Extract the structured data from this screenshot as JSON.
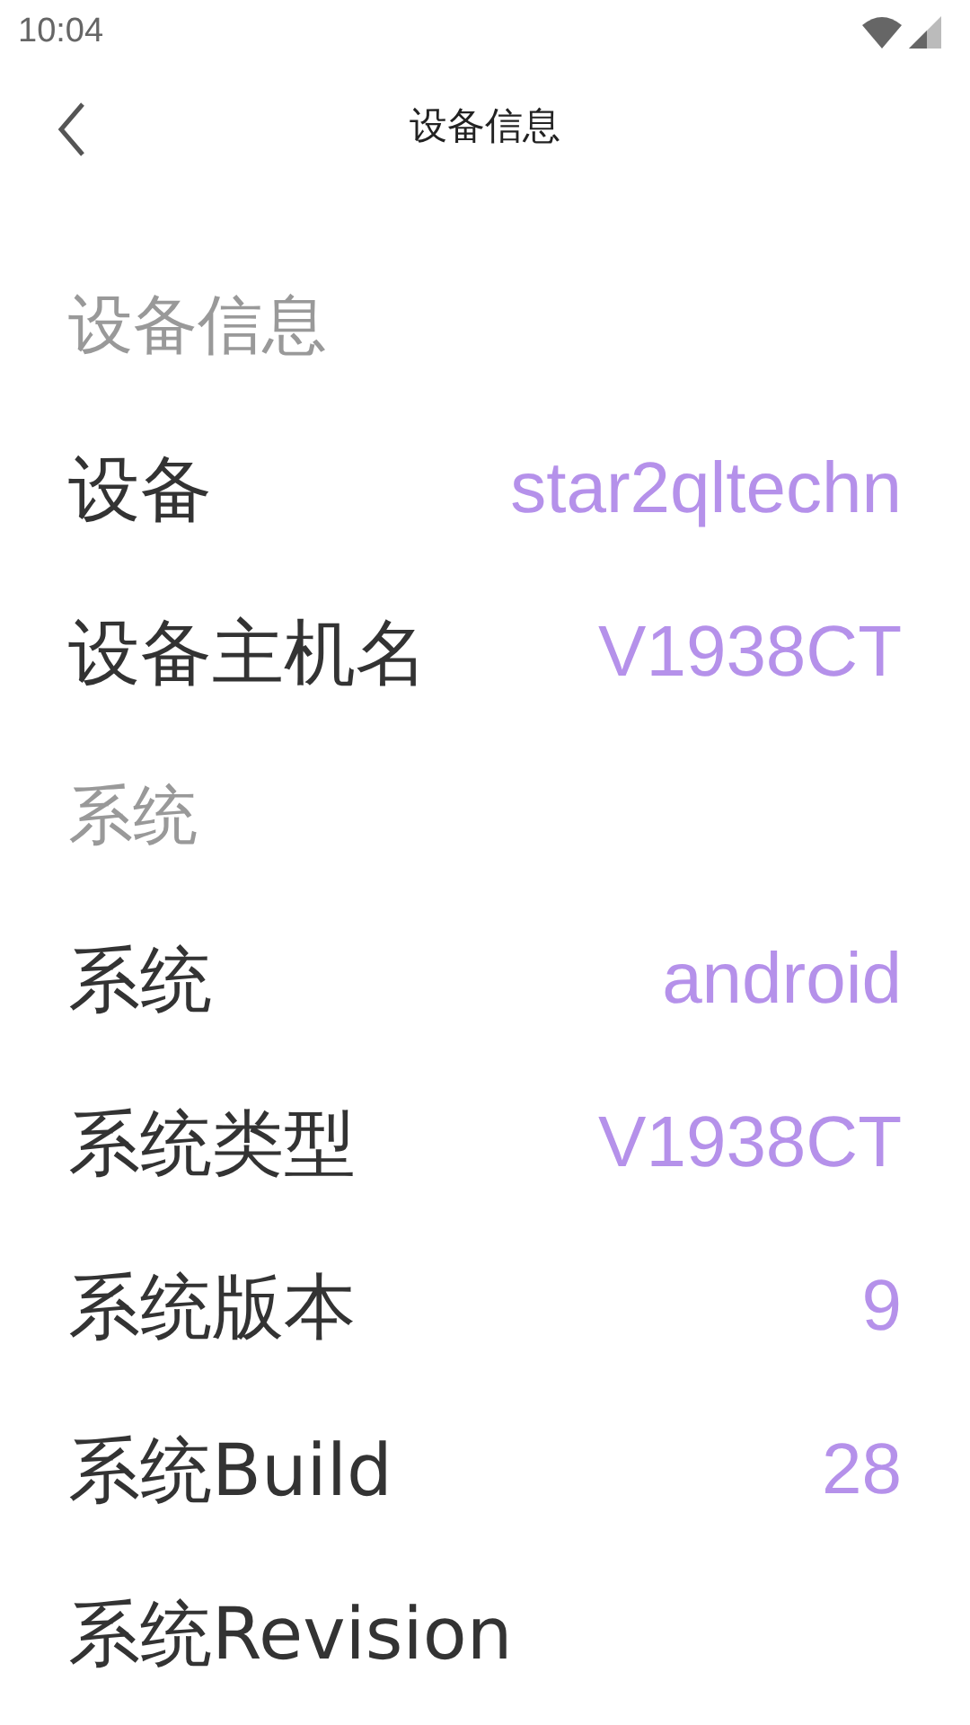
{
  "status_bar": {
    "time": "10:04"
  },
  "header": {
    "title": "设备信息"
  },
  "sections": [
    {
      "title": "设备信息",
      "rows": [
        {
          "label": "设备",
          "value": "star2qltechn"
        },
        {
          "label": "设备主机名",
          "value": "V1938CT"
        }
      ]
    },
    {
      "title": "系统",
      "rows": [
        {
          "label": "系统",
          "value": "android"
        },
        {
          "label": "系统类型",
          "value": "V1938CT"
        },
        {
          "label": "系统版本",
          "value": "9"
        },
        {
          "label": "系统Build",
          "value": "28"
        },
        {
          "label": "系统Revision"
        }
      ]
    }
  ]
}
